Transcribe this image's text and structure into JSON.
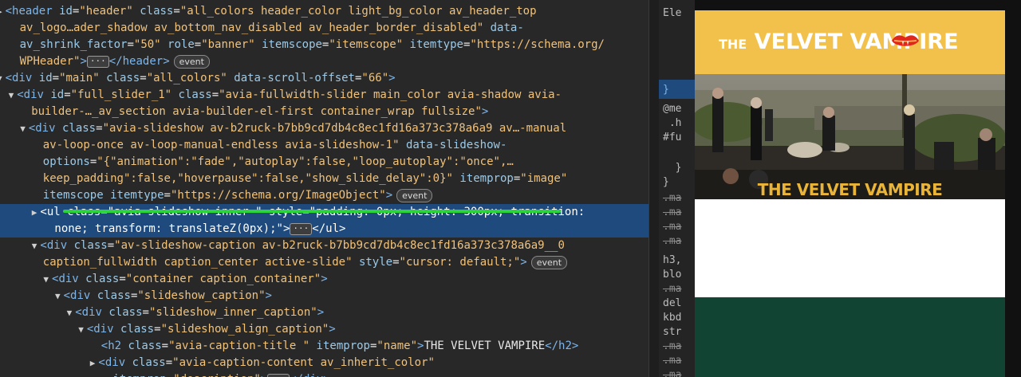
{
  "dom_lines": [
    {
      "indent": 0,
      "tri": "▶",
      "segs": [
        [
          "tag",
          "<header "
        ],
        [
          "attrname",
          "id"
        ],
        [
          "txt",
          "="
        ],
        [
          "val",
          "\"header\" "
        ],
        [
          "attrname",
          "class"
        ],
        [
          "txt",
          "="
        ],
        [
          "val",
          "\"all_colors header_color light_bg_color av_header_top"
        ]
      ]
    },
    {
      "indent": 1,
      "segs": [
        [
          "val",
          "av_logo…ader_shadow av_bottom_nav_disabled av_header_border_disabled\" "
        ],
        [
          "attrname",
          "data-"
        ]
      ]
    },
    {
      "indent": 1,
      "segs": [
        [
          "attrname",
          "av_shrink_factor"
        ],
        [
          "txt",
          "="
        ],
        [
          "val",
          "\"50\" "
        ],
        [
          "attrname",
          "role"
        ],
        [
          "txt",
          "="
        ],
        [
          "val",
          "\"banner\" "
        ],
        [
          "attrname",
          "itemscope"
        ],
        [
          "txt",
          "="
        ],
        [
          "val",
          "\"itemscope\" "
        ],
        [
          "attrname",
          "itemtype"
        ],
        [
          "txt",
          "="
        ],
        [
          "val",
          "\"https://schema.org/"
        ]
      ]
    },
    {
      "indent": 1,
      "segs": [
        [
          "val",
          "WPHeader\""
        ],
        [
          "tag",
          ">"
        ],
        [
          "ellip",
          "···"
        ],
        [
          "tag",
          "</header>"
        ],
        [
          "badge",
          "event"
        ]
      ]
    },
    {
      "indent": 0,
      "tri": "▼",
      "segs": [
        [
          "tag",
          "<div "
        ],
        [
          "attrname",
          "id"
        ],
        [
          "txt",
          "="
        ],
        [
          "val",
          "\"main\" "
        ],
        [
          "attrname",
          "class"
        ],
        [
          "txt",
          "="
        ],
        [
          "val",
          "\"all_colors\" "
        ],
        [
          "attrname",
          "data-scroll-offset"
        ],
        [
          "txt",
          "="
        ],
        [
          "val",
          "\"66\""
        ],
        [
          "tag",
          ">"
        ]
      ]
    },
    {
      "indent": 1,
      "tri": "▼",
      "segs": [
        [
          "tag",
          "<div "
        ],
        [
          "attrname",
          "id"
        ],
        [
          "txt",
          "="
        ],
        [
          "val",
          "\"full_slider_1\" "
        ],
        [
          "attrname",
          "class"
        ],
        [
          "txt",
          "="
        ],
        [
          "val",
          "\"avia-fullwidth-slider main_color avia-shadow avia-"
        ]
      ]
    },
    {
      "indent": 2,
      "segs": [
        [
          "val",
          "builder-…_av_section avia-builder-el-first container_wrap fullsize\""
        ],
        [
          "tag",
          ">"
        ]
      ]
    },
    {
      "indent": 2,
      "tri": "▼",
      "segs": [
        [
          "tag",
          "<div "
        ],
        [
          "attrname",
          "class"
        ],
        [
          "txt",
          "="
        ],
        [
          "val",
          "\"avia-slideshow av-b2ruck-b7bb9cd7db4c8ec1fd16a373c378a6a9 av…-manual"
        ]
      ]
    },
    {
      "indent": 3,
      "segs": [
        [
          "val",
          "av-loop-once av-loop-manual-endless avia-slideshow-1\" "
        ],
        [
          "attrname",
          "data-slideshow-"
        ]
      ]
    },
    {
      "indent": 3,
      "segs": [
        [
          "attrname",
          "options"
        ],
        [
          "txt",
          "="
        ],
        [
          "val",
          "\"{\"animation\":\"fade\",\"autoplay\":false,\"loop_autoplay\":\"once\",…"
        ]
      ]
    },
    {
      "indent": 3,
      "segs": [
        [
          "val",
          "keep_padding\":false,\"hoverpause\":false,\"show_slide_delay\":0}\" "
        ],
        [
          "attrname",
          "itemprop"
        ],
        [
          "txt",
          "="
        ],
        [
          "val",
          "\"image\""
        ]
      ]
    },
    {
      "indent": 3,
      "segs": [
        [
          "attrname",
          "itemscope "
        ],
        [
          "attrname",
          "itemtype"
        ],
        [
          "txt",
          "="
        ],
        [
          "val",
          "\"https://schema.org/ImageObject\""
        ],
        [
          "tag",
          ">"
        ],
        [
          "badge",
          "event"
        ]
      ]
    },
    {
      "indent": 3,
      "tri": "▶",
      "sel": true,
      "segs": [
        [
          "tag",
          "<ul "
        ],
        [
          "attrname",
          "class"
        ],
        [
          "txt",
          "="
        ],
        [
          "val",
          "\"avia-slideshow-inner \" "
        ],
        [
          "attrname",
          "style"
        ],
        [
          "txt",
          "="
        ],
        [
          "val",
          "\"padding: 0px; height: 300px; transition:"
        ]
      ]
    },
    {
      "indent": 4,
      "sel": true,
      "segs": [
        [
          "val",
          "none; transform: translateZ(0px);\""
        ],
        [
          "tag",
          ">"
        ],
        [
          "ellip",
          "···"
        ],
        [
          "tag",
          "</ul>"
        ]
      ]
    },
    {
      "indent": 3,
      "tri": "▼",
      "segs": [
        [
          "tag",
          "<div "
        ],
        [
          "attrname",
          "class"
        ],
        [
          "txt",
          "="
        ],
        [
          "val",
          "\"av-slideshow-caption av-b2ruck-b7bb9cd7db4c8ec1fd16a373c378a6a9__0"
        ]
      ]
    },
    {
      "indent": 3,
      "segs": [
        [
          "val",
          "caption_fullwidth caption_center active-slide\" "
        ],
        [
          "attrname",
          "style"
        ],
        [
          "txt",
          "="
        ],
        [
          "val",
          "\"cursor: default;\""
        ],
        [
          "tag",
          ">"
        ],
        [
          "badge",
          "event"
        ]
      ]
    },
    {
      "indent": 4,
      "tri": "▼",
      "segs": [
        [
          "tag",
          "<div "
        ],
        [
          "attrname",
          "class"
        ],
        [
          "txt",
          "="
        ],
        [
          "val",
          "\"container caption_container\""
        ],
        [
          "tag",
          ">"
        ]
      ]
    },
    {
      "indent": 5,
      "tri": "▼",
      "segs": [
        [
          "tag",
          "<div "
        ],
        [
          "attrname",
          "class"
        ],
        [
          "txt",
          "="
        ],
        [
          "val",
          "\"slideshow_caption\""
        ],
        [
          "tag",
          ">"
        ]
      ]
    },
    {
      "indent": 6,
      "tri": "▼",
      "segs": [
        [
          "tag",
          "<div "
        ],
        [
          "attrname",
          "class"
        ],
        [
          "txt",
          "="
        ],
        [
          "val",
          "\"slideshow_inner_caption\""
        ],
        [
          "tag",
          ">"
        ]
      ]
    },
    {
      "indent": 7,
      "tri": "▼",
      "segs": [
        [
          "tag",
          "<div "
        ],
        [
          "attrname",
          "class"
        ],
        [
          "txt",
          "="
        ],
        [
          "val",
          "\"slideshow_align_caption\""
        ],
        [
          "tag",
          ">"
        ]
      ]
    },
    {
      "indent": 8,
      "segs": [
        [
          "tag",
          "<h2 "
        ],
        [
          "attrname",
          "class"
        ],
        [
          "txt",
          "="
        ],
        [
          "val",
          "\"avia-caption-title \" "
        ],
        [
          "attrname",
          "itemprop"
        ],
        [
          "txt",
          "="
        ],
        [
          "val",
          "\"name\""
        ],
        [
          "tag",
          ">"
        ],
        [
          "txt",
          "THE VELVET VAMPIRE"
        ],
        [
          "tag",
          "</h2>"
        ]
      ]
    },
    {
      "indent": 8,
      "tri": "▶",
      "segs": [
        [
          "tag",
          "<div "
        ],
        [
          "attrname",
          "class"
        ],
        [
          "txt",
          "="
        ],
        [
          "val",
          "\"avia-caption-content av_inherit_color\""
        ]
      ]
    },
    {
      "indent": 9,
      "segs": [
        [
          "attrname",
          "itemprop"
        ],
        [
          "txt",
          "="
        ],
        [
          "val",
          "\"description\""
        ],
        [
          "tag",
          ">"
        ],
        [
          "ellip",
          "···"
        ],
        [
          "tag",
          "</div>"
        ]
      ]
    }
  ],
  "side_lines": [
    {
      "t": "Ele",
      "cls": ""
    },
    {
      "t": "}",
      "cls": "blue"
    },
    {
      "t": "@me",
      "cls": ""
    },
    {
      "t": " .h",
      "cls": ""
    },
    {
      "t": "#fu",
      "cls": ""
    },
    {
      "t": "",
      "cls": ""
    },
    {
      "t": "  }",
      "cls": ""
    },
    {
      "t": "}",
      "cls": ""
    },
    {
      "t": ".ma",
      "cls": "strike"
    },
    {
      "t": ".ma",
      "cls": "strike"
    },
    {
      "t": ".ma",
      "cls": "strike"
    },
    {
      "t": ".ma",
      "cls": "strike"
    },
    {
      "t": "h3,",
      "cls": ""
    },
    {
      "t": "blo",
      "cls": ""
    },
    {
      "t": ".ma",
      "cls": "strike"
    },
    {
      "t": "del",
      "cls": ""
    },
    {
      "t": "kbd",
      "cls": ""
    },
    {
      "t": "str",
      "cls": ""
    },
    {
      "t": ".ma",
      "cls": "strike"
    },
    {
      "t": ".ma",
      "cls": "strike"
    },
    {
      "t": ".ma",
      "cls": "strike"
    }
  ],
  "preview": {
    "logo_small": "THE",
    "logo_main": "VELVET VAMPIRE",
    "caption_title": "THE VELVET VAMPIRE"
  },
  "colors": {
    "header_bg": "#f2c14b",
    "caption_gold": "#e9b438",
    "green_band": "#124434",
    "highlight_underline": "#2ad43a",
    "selection": "#1f4a7d"
  }
}
